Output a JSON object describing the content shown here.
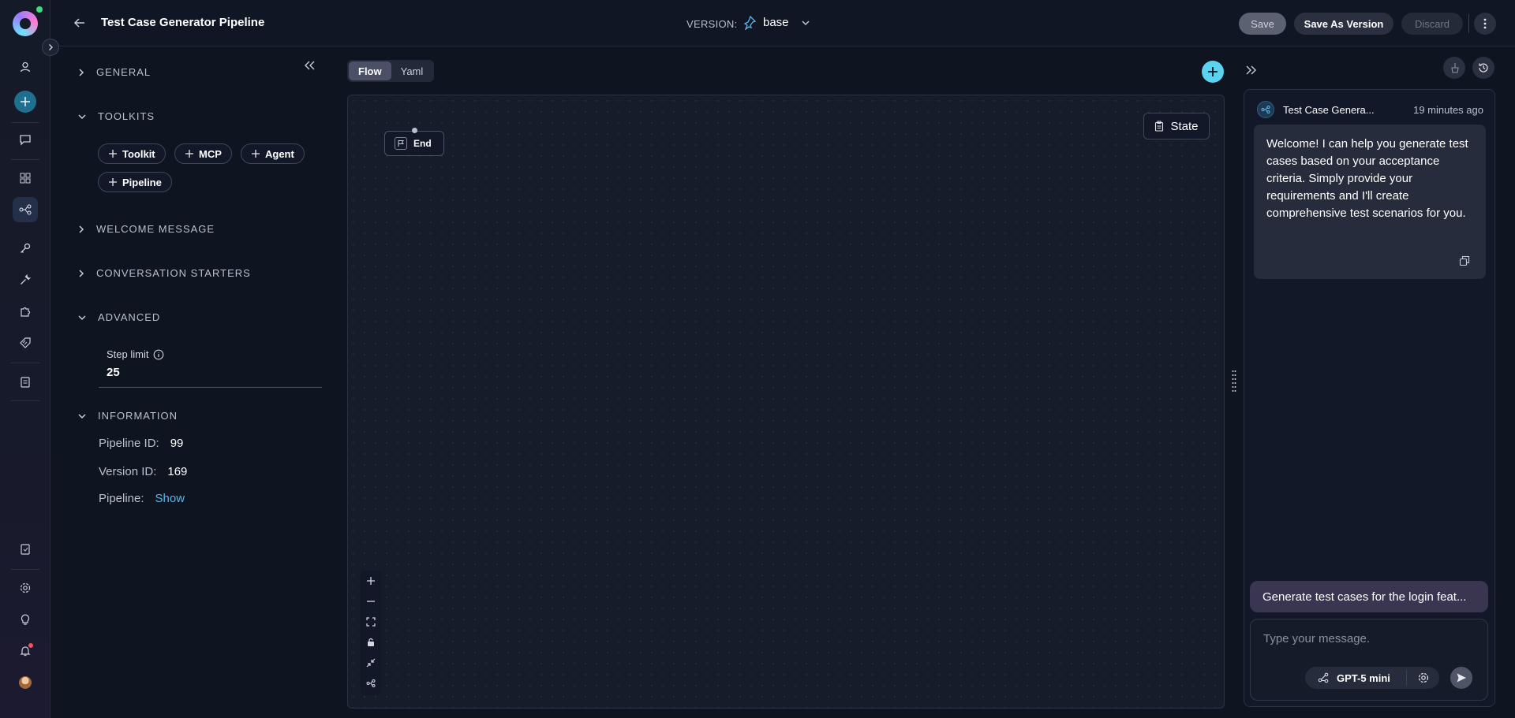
{
  "header": {
    "title": "Test Case Generator Pipeline",
    "version_label": "VERSION:",
    "version_value": "base",
    "save_label": "Save",
    "save_as_version_label": "Save As Version",
    "discard_label": "Discard"
  },
  "rail": {
    "icons": [
      "user-icon",
      "add-icon",
      "chat-icon",
      "grid-icon",
      "pipeline-icon",
      "key-icon",
      "wrench-icon",
      "puzzle-icon",
      "tag-icon",
      "documents-icon",
      "notes-icon",
      "settings-icon",
      "lightbulb-icon",
      "bell-icon",
      "avatar"
    ]
  },
  "config": {
    "sections": {
      "general": "GENERAL",
      "toolkits": "TOOLKITS",
      "welcome_message": "WELCOME MESSAGE",
      "conversation_starters": "CONVERSATION STARTERS",
      "advanced": "ADVANCED",
      "information": "INFORMATION"
    },
    "toolkit_buttons": {
      "toolkit": "Toolkit",
      "mcp": "MCP",
      "agent": "Agent",
      "pipeline": "Pipeline"
    },
    "step_limit": {
      "label": "Step limit",
      "value": "25"
    },
    "information": {
      "pipeline_id_label": "Pipeline ID:",
      "pipeline_id_value": "99",
      "version_id_label": "Version ID:",
      "version_id_value": "169",
      "pipeline_label": "Pipeline:",
      "pipeline_link": "Show"
    }
  },
  "canvas": {
    "tabs": {
      "flow": "Flow",
      "yaml": "Yaml"
    },
    "active_tab": "Flow",
    "state_button": "State",
    "end_node_label": "End"
  },
  "chat": {
    "agent_name": "Test Case Genera...",
    "timestamp": "19 minutes ago",
    "welcome_message": "Welcome! I can help you generate test cases based on your acceptance criteria. Simply provide your requirements and I'll create comprehensive test scenarios for you.",
    "user_message": "Generate test cases for the login feat...",
    "input_placeholder": "Type your message.",
    "model_name": "GPT-5 mini"
  },
  "colors": {
    "accent": "#5ad2f0",
    "background": "#0f1421",
    "status_online": "#41d97c",
    "notification": "#ff4d5e",
    "link": "#5ab8e8"
  }
}
